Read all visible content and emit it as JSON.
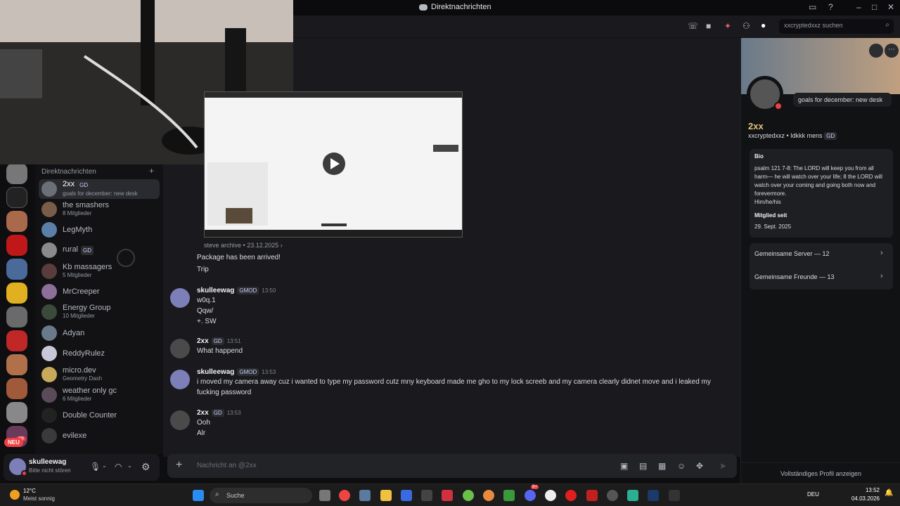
{
  "window": {
    "title": "Direktnachrichten",
    "search_placeholder": "xxcryptedxxz suchen"
  },
  "sidebar": {
    "dm_header": "Direktnachrichten",
    "add_label": "+",
    "dms": [
      {
        "name": "2xx",
        "badge": "GD",
        "sub": "goals for december: new desk",
        "color": "#6b6f78"
      },
      {
        "name": "the smashers",
        "sub": "8 Mitglieder",
        "color": "#7a5c4a"
      },
      {
        "name": "LegMyth",
        "sub": "",
        "color": "#5b7fa6"
      },
      {
        "name": "rural",
        "badge": "GD",
        "sub": "",
        "color": "#8a8a8a"
      },
      {
        "name": "Kb massagers",
        "sub": "5 Mitglieder",
        "color": "#5a3c3c"
      },
      {
        "name": "MrCreeper",
        "sub": "",
        "color": "#8d6f9a"
      },
      {
        "name": "Energy Group",
        "sub": "10 Mitglieder",
        "color": "#3c4a3c"
      },
      {
        "name": "Adyan",
        "sub": "",
        "color": "#6a7a8a"
      },
      {
        "name": "ReddyRulez",
        "sub": "",
        "color": "#c8c8d8"
      },
      {
        "name": "micro.dev",
        "sub": "Geometry Dash",
        "color": "#c8a85a"
      },
      {
        "name": "weather only gc",
        "sub": "6 Mitglieder",
        "color": "#5a4a5a"
      },
      {
        "name": "Double Counter",
        "sub": "",
        "color": "#222"
      },
      {
        "name": "evilexe",
        "sub": "",
        "color": "#3a3a3a"
      }
    ],
    "server_badge": "29",
    "new_badge": "NEU"
  },
  "user_panel": {
    "name": "skulleewag",
    "status": "Bitte nicht stören"
  },
  "chat": {
    "forward_meta": "steve archive",
    "forward_date": "23.12.2025",
    "pre_lines": [
      "Package has been arrived!",
      "Trip"
    ],
    "messages": [
      {
        "user": "skulleewag",
        "tag": "GMOD",
        "time": "13:50",
        "lines": [
          "w0q.1",
          " Qqw/",
          "+. SW"
        ],
        "color": "#7c7fb8"
      },
      {
        "user": "2xx",
        "tag": "GD",
        "time": "13:51",
        "lines": [
          "What happend"
        ],
        "color": "#4a4a4a"
      },
      {
        "user": "skulleewag",
        "tag": "GMOD",
        "time": "13:53",
        "lines": [
          "i moved my camera away cuz i wanted to type my password cutz mny keyboard made me gho to my lock screeb and my camera clearly didnet move and i leaked my",
          "fucking password"
        ],
        "color": "#7c7fb8"
      },
      {
        "user": "2xx",
        "tag": "GD",
        "time": "13:53",
        "lines": [
          "Ooh",
          "Alr"
        ],
        "color": "#4a4a4a"
      }
    ],
    "composer_placeholder": "Nachricht an @2xx"
  },
  "profile": {
    "status_bubble": "goals for december: new desk",
    "display_name": "2xx",
    "username": "xxcryptedxxz",
    "pronoun_text": "Idkkk mens",
    "badge": "GD",
    "bio_label": "Bio",
    "bio": "psalm 121 7-8: The LORD will keep you from all harm— he will watch over your life; 8 the LORD will watch over your coming and going both now and forevermore.",
    "pronouns": "Him/he/his",
    "member_since_label": "Mitglied seit",
    "member_since": "29. Sept. 2025",
    "mutual_servers": "Gemeinsame Server — 12",
    "mutual_friends": "Gemeinsame Freunde — 13",
    "full_profile": "Vollständiges Profil anzeigen"
  },
  "taskbar": {
    "weather_temp": "12°C",
    "weather_desc": "Meist sonnig",
    "search_label": "Suche",
    "lang": "DEU",
    "time": "13:52",
    "date": "04.03.2026",
    "discord_badge": "9+"
  },
  "colors": {
    "accent": "#5865f2",
    "dnd": "#f23f43",
    "online": "#23a55a"
  }
}
